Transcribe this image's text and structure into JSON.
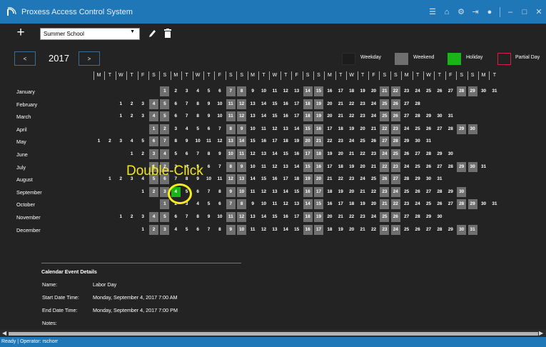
{
  "window": {
    "title": "Proxess Access Control System"
  },
  "toolbar": {
    "schedule_value": "Summer School"
  },
  "nav": {
    "year": "2017",
    "prev": "<",
    "next": ">"
  },
  "legend": [
    {
      "label": "Weekday",
      "color": "#232323"
    },
    {
      "label": "Weekend",
      "color": "#6f6f6f"
    },
    {
      "label": "Holiday",
      "color": "#19b41a"
    },
    {
      "label": "Partial Day",
      "color": "#d5214a"
    }
  ],
  "weekday_headers": [
    "M",
    "T",
    "W",
    "T",
    "F",
    "S",
    "S",
    "M",
    "T",
    "W",
    "T",
    "F",
    "S",
    "S",
    "M",
    "T",
    "W",
    "T",
    "F",
    "S",
    "S",
    "M",
    "T",
    "W",
    "T",
    "F",
    "S",
    "S",
    "M",
    "T",
    "W",
    "T",
    "F",
    "S",
    "S",
    "M",
    "T"
  ],
  "months": [
    {
      "name": "January",
      "start": 6,
      "days": 31
    },
    {
      "name": "February",
      "start": 2,
      "days": 28
    },
    {
      "name": "March",
      "start": 2,
      "days": 31
    },
    {
      "name": "April",
      "start": 5,
      "days": 30
    },
    {
      "name": "May",
      "start": 0,
      "days": 31
    },
    {
      "name": "June",
      "start": 3,
      "days": 30
    },
    {
      "name": "July",
      "start": 5,
      "days": 31
    },
    {
      "name": "August",
      "start": 1,
      "days": 31
    },
    {
      "name": "September",
      "start": 4,
      "days": 30
    },
    {
      "name": "October",
      "start": 6,
      "days": 31
    },
    {
      "name": "November",
      "start": 2,
      "days": 30
    },
    {
      "name": "December",
      "start": 4,
      "days": 31
    }
  ],
  "holidays": [
    {
      "month": 8,
      "day": 4
    }
  ],
  "annotation": {
    "label": "Double-Click"
  },
  "event_details": {
    "title": "Calendar Event Details",
    "name_label": "Name:",
    "name": "Labor Day",
    "start_label": "Start Date Time:",
    "start": "Monday, September 4, 2017 7:00 AM",
    "end_label": "End Date Time:",
    "end": "Monday, September 4, 2017 7:00 PM",
    "notes_label": "Notes:",
    "notes": ""
  },
  "status": {
    "ready": "Ready",
    "operator": "Operator: rschorr"
  }
}
